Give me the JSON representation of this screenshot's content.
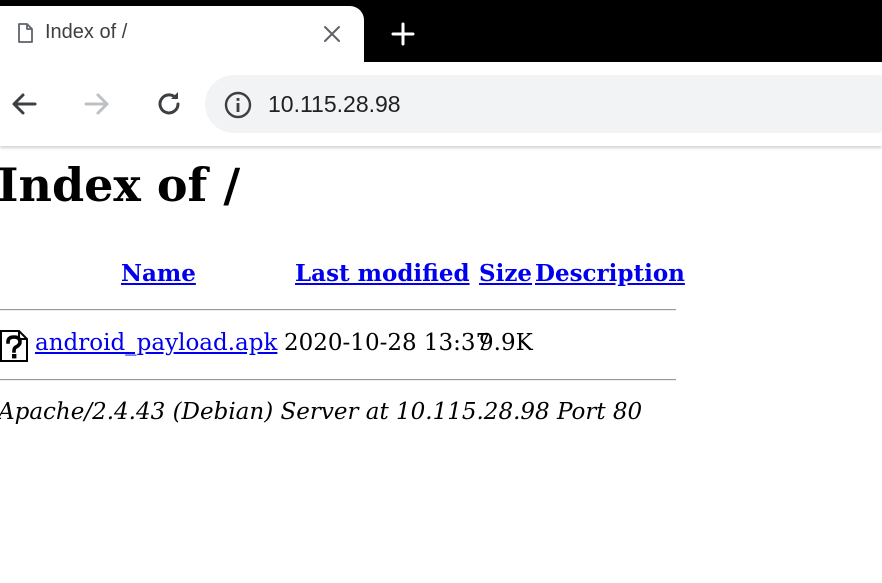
{
  "browser": {
    "tab": {
      "title": "Index of /",
      "icon": "document-icon"
    },
    "new_tab_icon": "plus-icon",
    "close_tab_icon": "close-icon",
    "nav": {
      "back_icon": "arrow-left-icon",
      "forward_icon": "arrow-right-icon",
      "reload_icon": "reload-icon"
    },
    "address_bar": {
      "security_icon": "info-icon",
      "url": "10.115.28.98"
    },
    "colors": {
      "tabstrip": "#000000",
      "omnibox": "#f1f3f4",
      "icon": "#3c4043",
      "icon_disabled": "#bdc1c6"
    }
  },
  "page": {
    "title": "Index of /",
    "columns": {
      "name": "Name",
      "last_modified": "Last modified",
      "size": "Size",
      "description": "Description"
    },
    "entries": [
      {
        "icon": "unknown-file-icon",
        "name": "android_payload.apk",
        "last_modified": "2020-10-28 13:37",
        "size": "9.9K",
        "description": ""
      }
    ],
    "server_signature": "Apache/2.4.43 (Debian) Server at 10.115.28.98 Port 80",
    "colors": {
      "link": "#0000ee",
      "text": "#000000"
    }
  }
}
